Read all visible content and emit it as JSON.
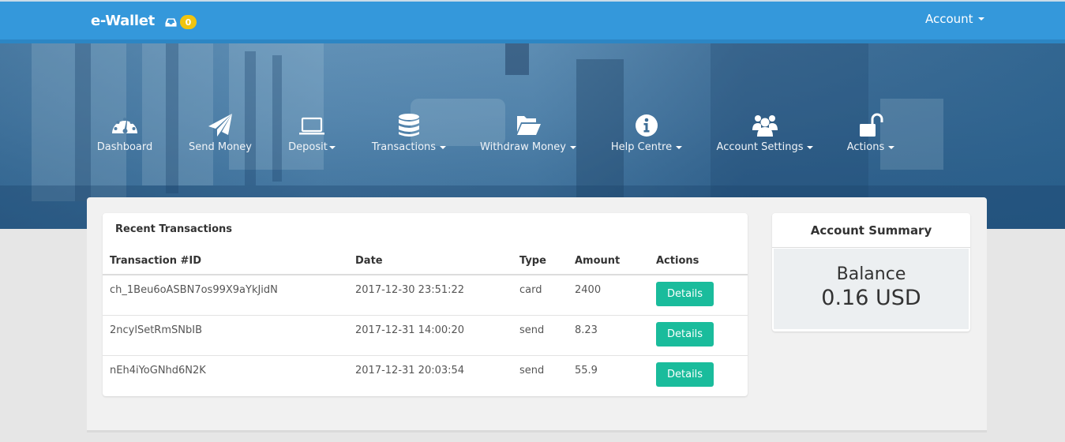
{
  "navbar": {
    "brand": "e-Wallet",
    "inbox_icon": "inbox-icon",
    "notification_count": "0",
    "account_label": "Account"
  },
  "nav": [
    {
      "label": "Dashboard",
      "icon": "dashboard-gauge-icon",
      "dropdown": false
    },
    {
      "label": "Send Money",
      "icon": "paper-plane-icon",
      "dropdown": false
    },
    {
      "label": "Deposit",
      "icon": "laptop-icon",
      "dropdown": true
    },
    {
      "label": "Transactions",
      "icon": "database-icon",
      "dropdown": true
    },
    {
      "label": "Withdraw Money",
      "icon": "folder-open-icon",
      "dropdown": true
    },
    {
      "label": "Help Centre",
      "icon": "info-circle-icon",
      "dropdown": true
    },
    {
      "label": "Account Settings",
      "icon": "users-icon",
      "dropdown": true
    },
    {
      "label": "Actions",
      "icon": "unlock-icon",
      "dropdown": true
    }
  ],
  "transactions": {
    "title": "Recent Transactions",
    "columns": [
      "Transaction #ID",
      "Date",
      "Type",
      "Amount",
      "Actions"
    ],
    "rows": [
      {
        "id": "ch_1Beu6oASBN7os99X9aYkJidN",
        "date": "2017-12-30 23:51:22",
        "type": "card",
        "amount": "2400",
        "action": "Details"
      },
      {
        "id": "2ncylSetRmSNbIB",
        "date": "2017-12-31 14:00:20",
        "type": "send",
        "amount": "8.23",
        "action": "Details"
      },
      {
        "id": "nEh4iYoGNhd6N2K",
        "date": "2017-12-31 20:03:54",
        "type": "send",
        "amount": "55.9",
        "action": "Details"
      }
    ]
  },
  "summary": {
    "title": "Account Summary",
    "balance_label": "Balance",
    "balance_value": "0.16 USD"
  },
  "colors": {
    "navbar": "#3498db",
    "badge": "#f1c40f",
    "details_button": "#1abc9c"
  }
}
